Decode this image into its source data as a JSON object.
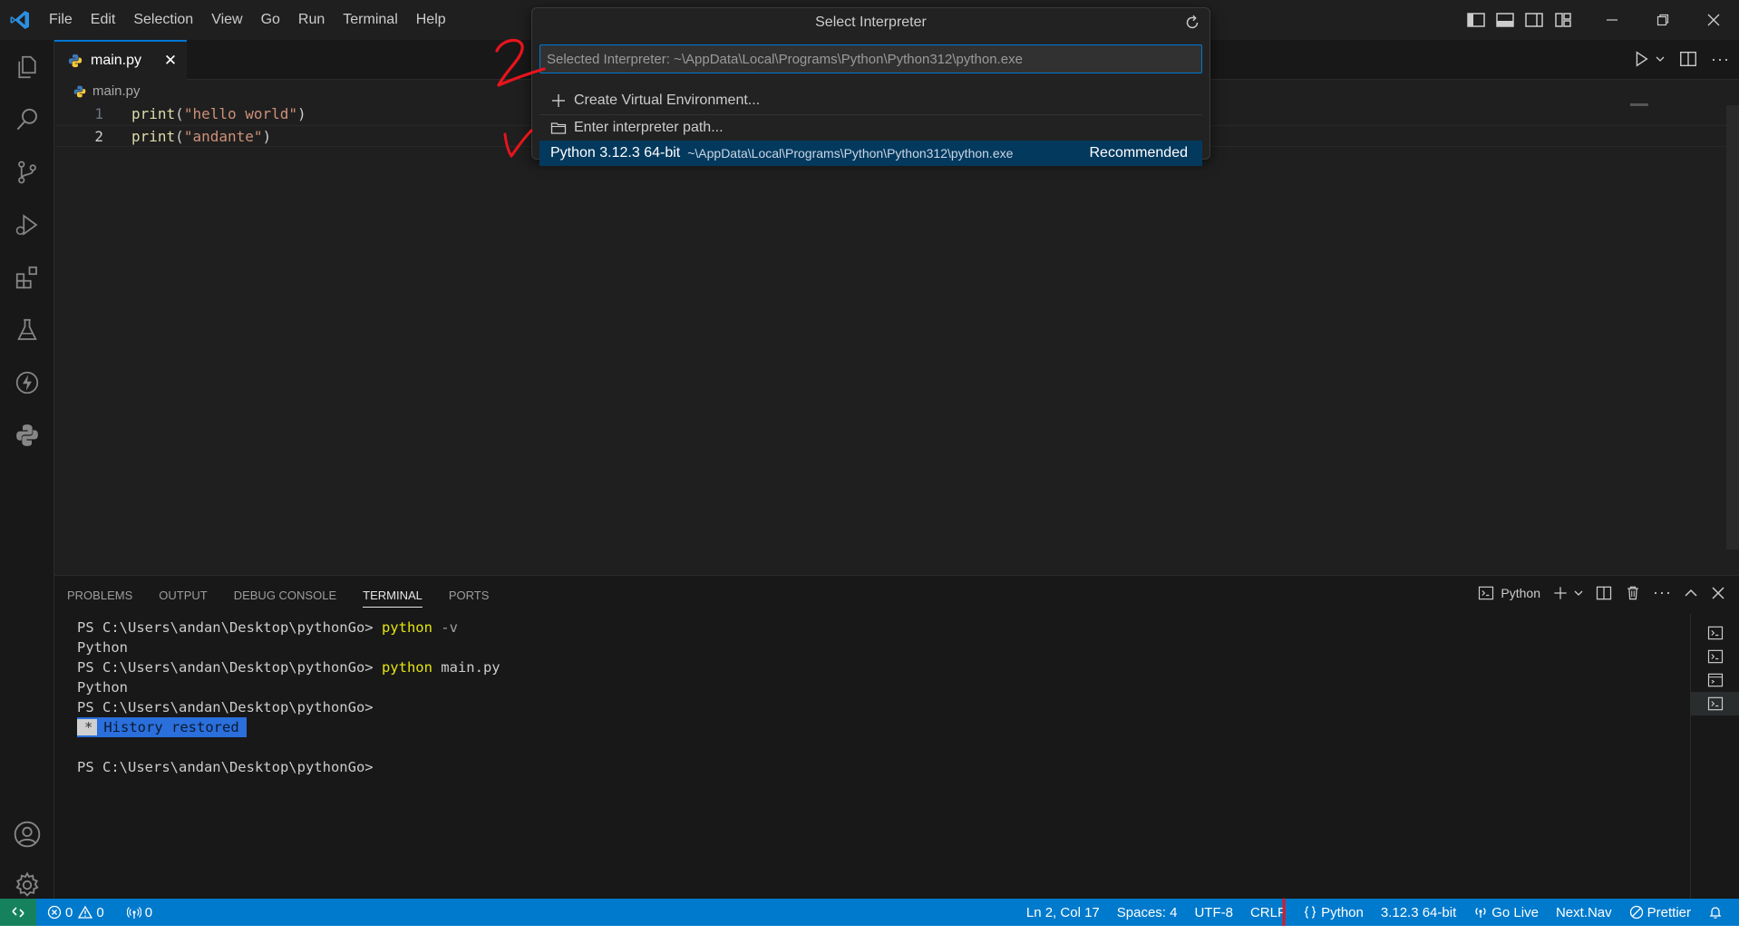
{
  "menu": [
    "File",
    "Edit",
    "Selection",
    "View",
    "Go",
    "Run",
    "Terminal",
    "Help"
  ],
  "editor": {
    "tab_label": "main.py",
    "tab_close": "✕",
    "breadcrumb": "main.py",
    "lines": [
      {
        "num": "1",
        "fn": "print",
        "open": "(",
        "str": "\"hello world\"",
        "close": ")"
      },
      {
        "num": "2",
        "fn": "print",
        "open": "(",
        "str": "\"andante\"",
        "close": ")"
      }
    ]
  },
  "quickpick": {
    "title": "Select Interpreter",
    "placeholder": "Selected Interpreter: ~\\AppData\\Local\\Programs\\Python\\Python312\\python.exe",
    "create_venv": "Create Virtual Environment...",
    "enter_path": "Enter interpreter path...",
    "interpreter_name": "Python 3.12.3 64-bit",
    "interpreter_path": "~\\AppData\\Local\\Programs\\Python\\Python312\\python.exe",
    "interpreter_tag": "Recommended"
  },
  "panel": {
    "tabs": [
      "PROBLEMS",
      "OUTPUT",
      "DEBUG CONSOLE",
      "TERMINAL",
      "PORTS"
    ],
    "active_tab": "TERMINAL",
    "terminal_profile": "Python",
    "terminal": {
      "prompt": "PS C:\\Users\\andan\\Desktop\\pythonGo> ",
      "cmd1": "python",
      "cmd1_args": " -v",
      "out1": "Python",
      "cmd2": "python",
      "cmd2_args": " main.py",
      "out2": "Python",
      "prompt3": "PS C:\\Users\\andan\\Desktop\\pythonGo>",
      "history_star": "*",
      "history_text": "History restored",
      "prompt4": "PS C:\\Users\\andan\\Desktop\\pythonGo>"
    }
  },
  "statusbar": {
    "errors": "0",
    "warnings": "0",
    "ports": "0",
    "position": "Ln 2, Col 17",
    "spaces": "Spaces: 4",
    "encoding": "UTF-8",
    "eol": "CRLF",
    "language": "Python",
    "interpreter": "3.12.3 64-bit",
    "go_live": "Go Live",
    "next_nav": "Next.Nav",
    "prettier": "Prettier"
  },
  "colors": {
    "accent": "#0078d4",
    "statusbar": "#007acc",
    "annotation": "#e8141c"
  }
}
